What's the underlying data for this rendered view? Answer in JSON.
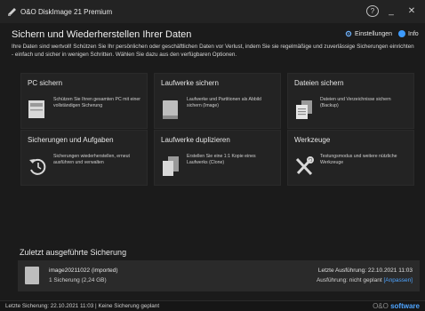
{
  "window": {
    "title": "O&O DiskImage 21 Premium",
    "help_label": "?",
    "minimize_label": "_",
    "close_label": "✕"
  },
  "header": {
    "title": "Sichern und Wiederherstellen Ihrer Daten",
    "settings_label": "Einstellungen",
    "info_label": "Info",
    "intro": "Ihre Daten sind wertvoll! Schützen Sie Ihr persönlichen oder geschäftlichen Daten vor Verlust, indem Sie sie regelmäßige und zuverlässige Sicherungen einrichten - einfach und sicher in wenigen Schritten. Wählen Sie dazu aus den verfügbaren Optionen."
  },
  "cards": [
    {
      "title": "PC sichern",
      "desc": "Schützen Sie Ihren gesamten PC mit einer vollständigen Sicherung",
      "icon": "pc-icon"
    },
    {
      "title": "Laufwerke sichern",
      "desc": "Laufwerke und Partitionen als Abbild sichern (Image)",
      "icon": "drive-icon"
    },
    {
      "title": "Dateien sichern",
      "desc": "Dateien und Verzeichnisse sichern (Backup)",
      "icon": "files-icon"
    },
    {
      "title": "Sicherungen und Aufgaben",
      "desc": "Sicherungen wiederherstellen, erneut ausführen und verwalten",
      "icon": "restore-icon"
    },
    {
      "title": "Laufwerke duplizieren",
      "desc": "Erstellen Sie eine 1:1 Kopie eines Laufwerks (Clone)",
      "icon": "duplicate-icon"
    },
    {
      "title": "Werkzeuge",
      "desc": "Testungsmodus und weitere nützliche Werkzeuge",
      "icon": "tools-icon"
    }
  ],
  "recent": {
    "title": "Zuletzt ausgeführte Sicherung",
    "name": "image20211022 (imported)",
    "count": "1 Sicherung (2,24 GB)",
    "last_run": "Letzte Ausführung: 22.10.2021 11:03",
    "schedule_prefix": "Ausführung: nicht geplant",
    "schedule_link": "[Anpassen]"
  },
  "status": {
    "text": "Letzte Sicherung: 22.10.2021 11:03 | Keine Sicherung geplant",
    "brand_prefix": "O&O",
    "brand_name": "software"
  },
  "colors": {
    "background": "#1b1b1b",
    "card": "#232323",
    "accent": "#4ea4ff",
    "info_blue": "#3d9bff"
  }
}
